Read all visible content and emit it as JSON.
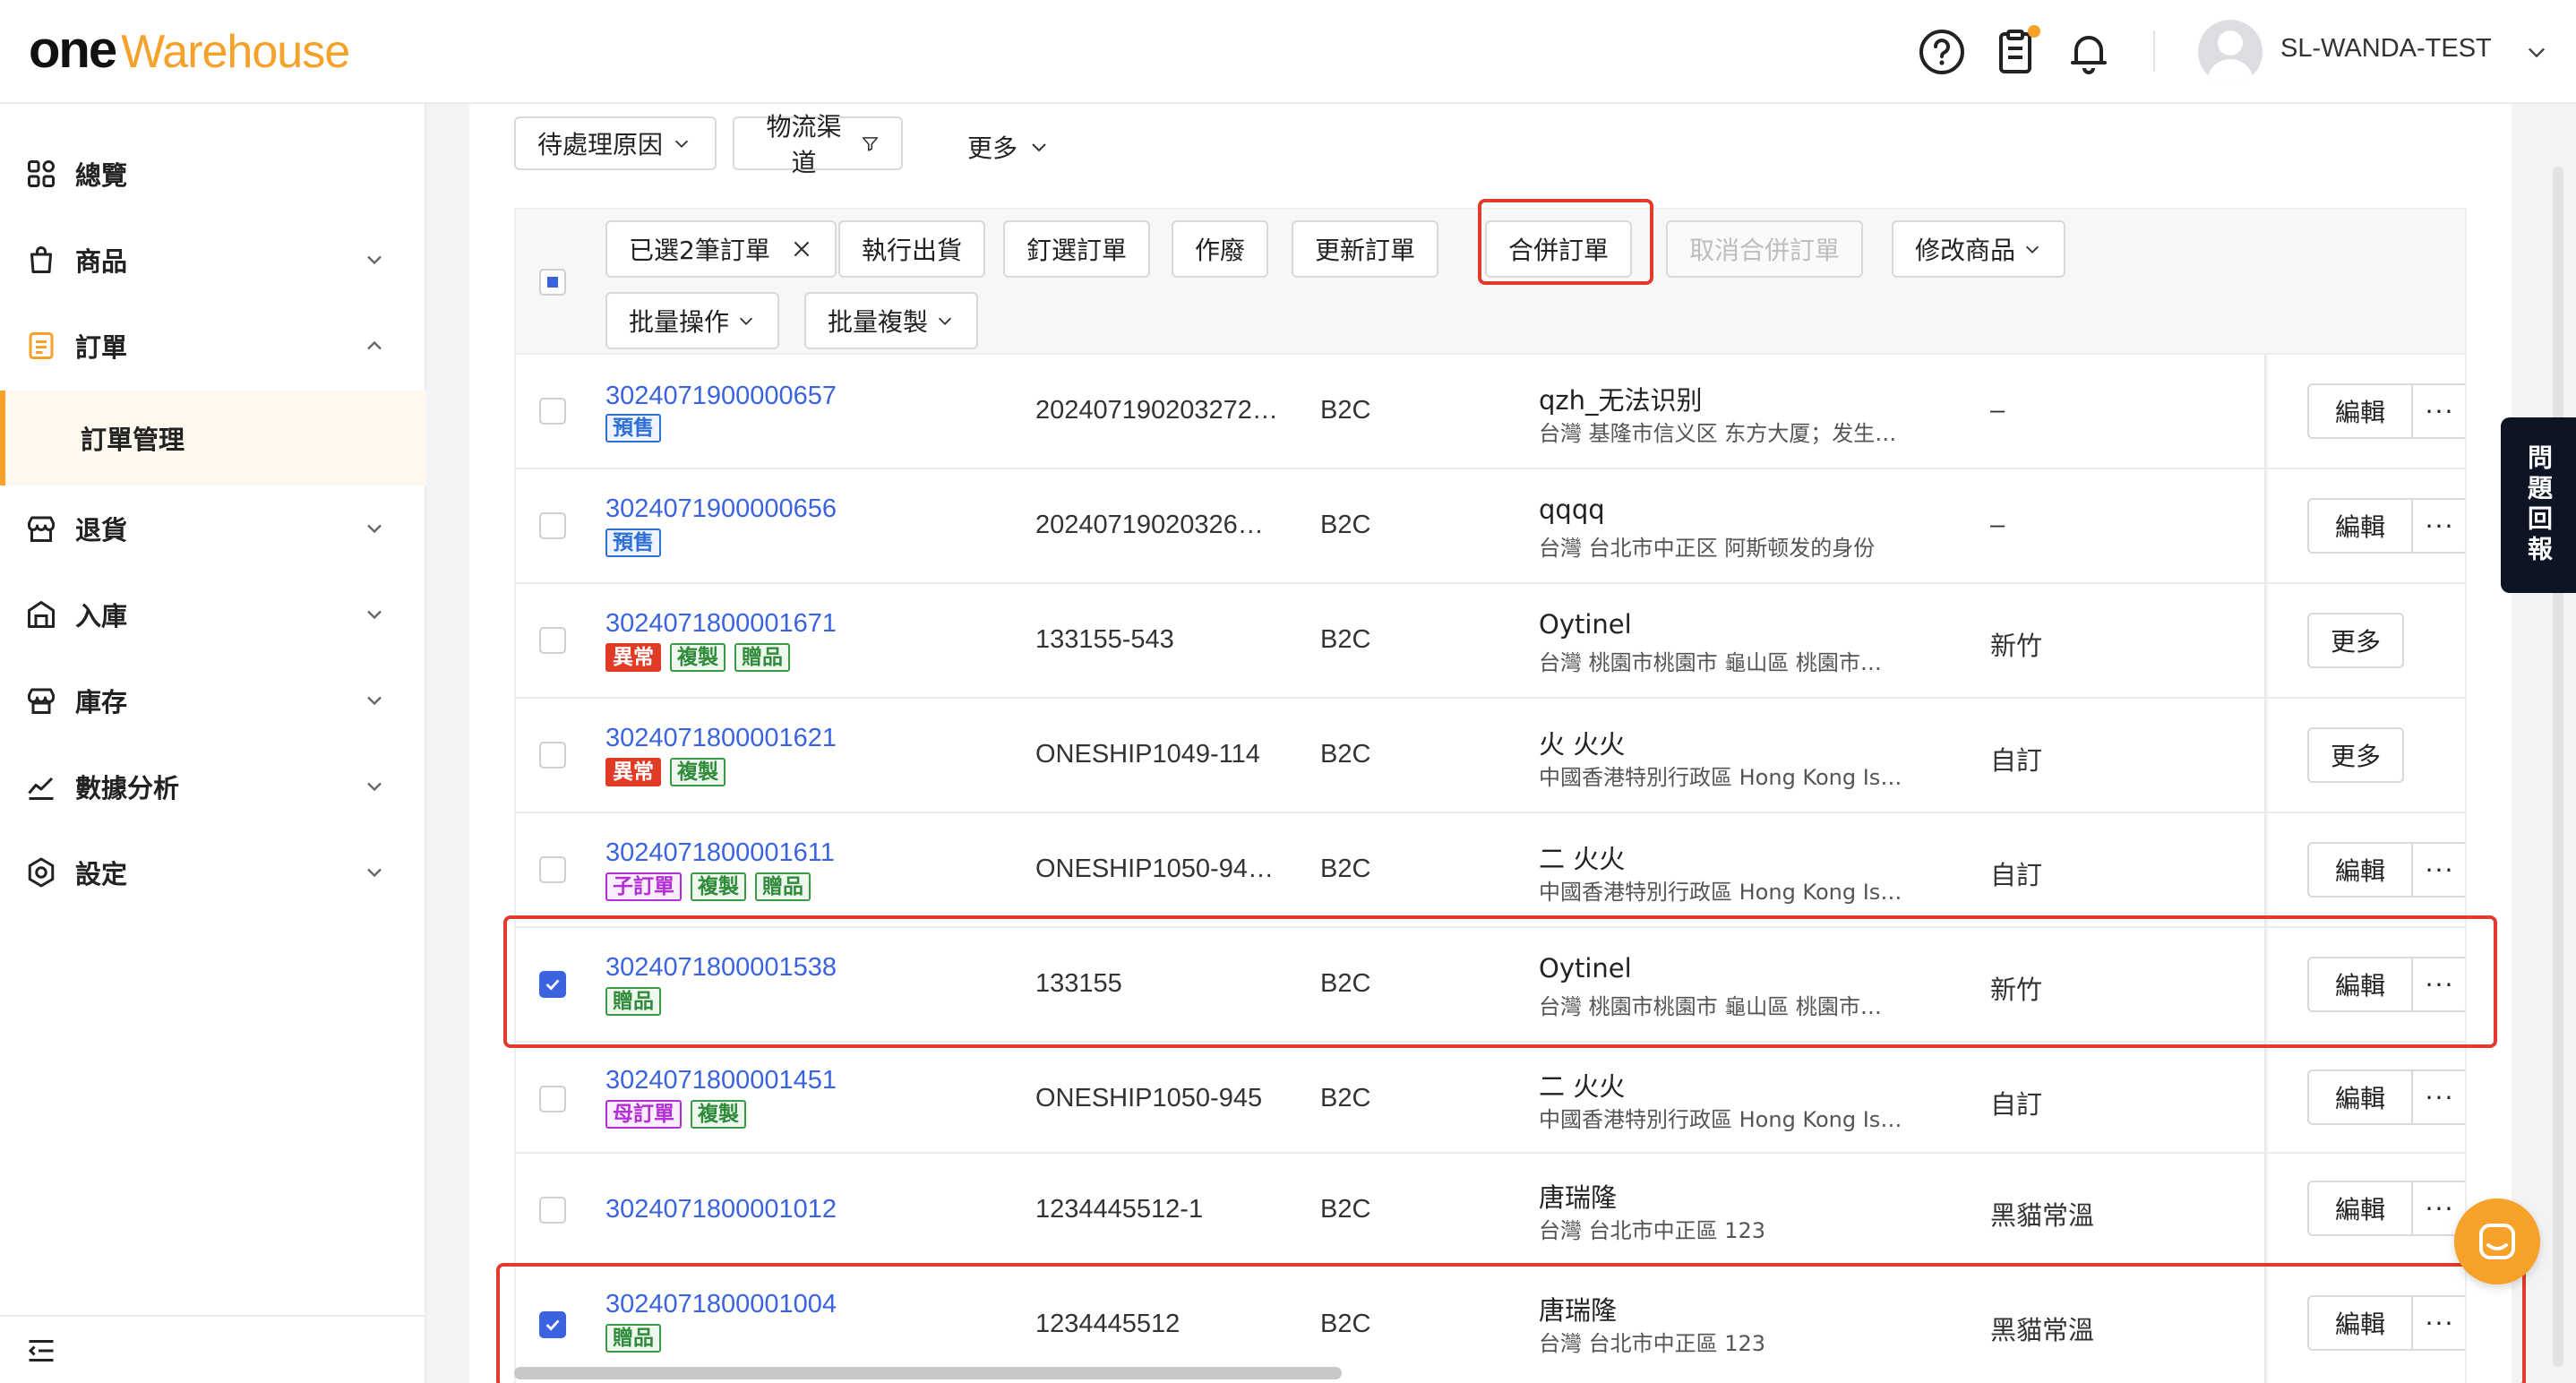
{
  "app": {
    "logo_one": "one",
    "logo_warehouse": "Warehouse"
  },
  "header": {
    "username": "SL-WANDA-TEST"
  },
  "sidebar": {
    "items": [
      {
        "label": "總覽"
      },
      {
        "label": "商品"
      },
      {
        "label": "訂單"
      },
      {
        "label": "訂單管理"
      },
      {
        "label": "退貨"
      },
      {
        "label": "入庫"
      },
      {
        "label": "庫存"
      },
      {
        "label": "數據分析"
      },
      {
        "label": "設定"
      }
    ]
  },
  "filters": {
    "pending_reason": "待處理原因",
    "logistics_channel": "物流渠道",
    "more": "更多"
  },
  "toolbar": {
    "selected": "已選2筆訂單",
    "ship": "執行出貨",
    "pin": "釘選訂單",
    "void": "作廢",
    "update": "更新訂單",
    "merge": "合併訂單",
    "unmerge": "取消合併訂單",
    "edit_products": "修改商品",
    "batch_ops": "批量操作",
    "batch_copy": "批量複製"
  },
  "actions": {
    "edit": "編輯",
    "dots": "···",
    "more": "更多"
  },
  "rows": [
    {
      "id": "3024071900000657",
      "tags": [
        "預售"
      ],
      "ref": "202407190203272…",
      "type": "B2C",
      "name": "qzh_无法识别",
      "addr": "台灣 基隆市信义区 东方大厦；发生…",
      "logistics": "–",
      "checked": false,
      "action": "edit"
    },
    {
      "id": "3024071900000656",
      "tags": [
        "預售"
      ],
      "ref": "20240719020326…",
      "type": "B2C",
      "name": "qqqq",
      "addr": "台灣 台北市中正区 阿斯顿发的身份",
      "logistics": "–",
      "checked": false,
      "action": "edit"
    },
    {
      "id": "3024071800001671",
      "tags": [
        "異常",
        "複製",
        "贈品"
      ],
      "ref": "133155-543",
      "type": "B2C",
      "name": "Oytinel",
      "addr": "台灣 桃園市桃園市 龜山區 桃園市…",
      "logistics": "新竹",
      "checked": false,
      "action": "more"
    },
    {
      "id": "3024071800001621",
      "tags": [
        "異常",
        "複製"
      ],
      "ref": "ONESHIP1049-114",
      "type": "B2C",
      "name": "火 火火",
      "addr": "中國香港特別行政區 Hong Kong Is…",
      "logistics": "自訂",
      "checked": false,
      "action": "more"
    },
    {
      "id": "3024071800001611",
      "tags": [
        "子訂單",
        "複製",
        "贈品"
      ],
      "ref": "ONESHIP1050-94…",
      "type": "B2C",
      "name": "二 火火",
      "addr": "中國香港特別行政區 Hong Kong Is…",
      "logistics": "自訂",
      "checked": false,
      "action": "edit"
    },
    {
      "id": "3024071800001538",
      "tags": [
        "贈品"
      ],
      "ref": "133155",
      "type": "B2C",
      "name": "Oytinel",
      "addr": "台灣 桃園市桃園市 龜山區 桃園市…",
      "logistics": "新竹",
      "checked": true,
      "action": "edit"
    },
    {
      "id": "3024071800001451",
      "tags": [
        "母訂單",
        "複製"
      ],
      "ref": "ONESHIP1050-945",
      "type": "B2C",
      "name": "二 火火",
      "addr": "中國香港特別行政區 Hong Kong Is…",
      "logistics": "自訂",
      "checked": false,
      "action": "edit"
    },
    {
      "id": "3024071800001012",
      "tags": [],
      "ref": "1234445512-1",
      "type": "B2C",
      "name": "唐瑞隆",
      "addr": "台灣 台北市中正區 123",
      "logistics": "黑貓常溫",
      "checked": false,
      "action": "edit"
    },
    {
      "id": "3024071800001004",
      "tags": [
        "贈品"
      ],
      "ref": "1234445512",
      "type": "B2C",
      "name": "唐瑞隆",
      "addr": "台灣 台北市中正區 123",
      "logistics": "黑貓常溫",
      "checked": true,
      "action": "edit"
    }
  ],
  "feedback": {
    "label": "問題回報"
  },
  "colors": {
    "accent": "#f5a12a",
    "link": "#3b63e0",
    "highlight_box": "#e23b2e"
  }
}
